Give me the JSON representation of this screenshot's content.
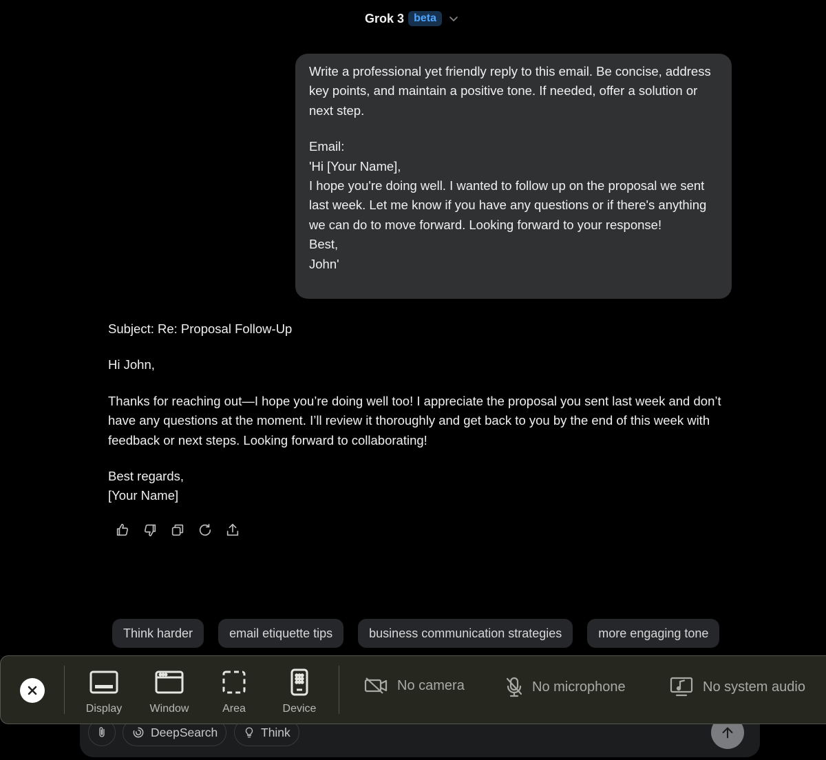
{
  "header": {
    "title": "Grok 3",
    "badge": "beta"
  },
  "user_message": {
    "lines": [
      "Write a professional yet friendly reply to this email. Be concise, address key points, and maintain a positive tone. If needed, offer a solution or next step.",
      "Email:\n'Hi [Your Name],\nI hope you're doing well. I wanted to follow up on the proposal we sent last week. Let me know if you have any questions or if there's anything we can do to move forward. Looking forward to your response!\nBest,\nJohn'"
    ]
  },
  "reply": {
    "subject": "Subject: Re: Proposal Follow-Up",
    "greeting": "Hi John,",
    "body": "Thanks for reaching out—I hope you’re doing well too! I appreciate the proposal you sent last week and don’t have any questions at the moment. I’ll review it thoroughly and get back to you by the end of this week with feedback or next steps. Looking forward to collaborating!",
    "signoff": "Best regards,\n[Your Name]"
  },
  "actions": [
    "thumbs-up-icon",
    "thumbs-down-icon",
    "copy-icon",
    "regenerate-icon",
    "share-icon"
  ],
  "suggestions": [
    "Think harder",
    "email etiquette tips",
    "business communication strategies",
    "more engaging tone"
  ],
  "composer": {
    "deepsearch_label": "DeepSearch",
    "think_label": "Think"
  },
  "capture_toolbar": {
    "tools": [
      "Display",
      "Window",
      "Area",
      "Device"
    ],
    "camera": "No camera",
    "microphone": "No microphone",
    "system_audio": "No system audio"
  },
  "colors": {
    "background": "#000000",
    "bubble": "#303133",
    "chip": "#26272a",
    "badge_text": "#4ea3ff",
    "toolbar": "#262820"
  }
}
